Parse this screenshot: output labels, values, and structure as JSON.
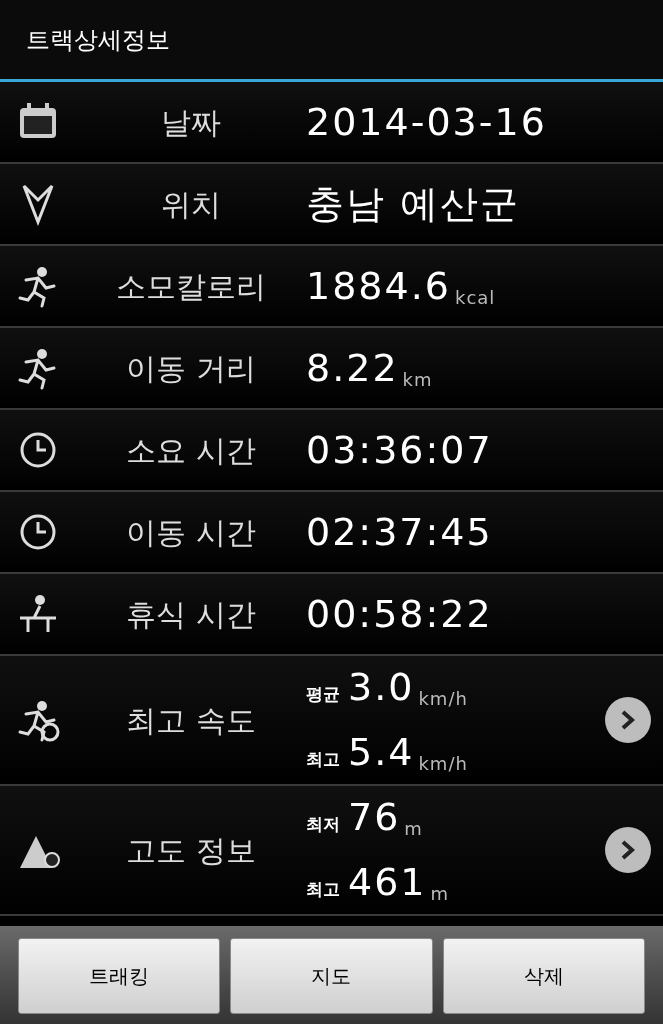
{
  "window": {
    "title": "트랙상세정보"
  },
  "rows": [
    {
      "kind": "single",
      "label": "날짜",
      "value": "2014-03-16"
    },
    {
      "kind": "single",
      "label": "위치",
      "value": "충남 예산군"
    },
    {
      "kind": "single",
      "label": "소모칼로리",
      "value": "1884.6",
      "unit": "kcal"
    },
    {
      "kind": "single",
      "label": "이동 거리",
      "value": "8.22",
      "unit": "km"
    },
    {
      "kind": "single",
      "label": "소요 시간",
      "value": "03:36:07"
    },
    {
      "kind": "single",
      "label": "이동 시간",
      "value": "02:37:45"
    },
    {
      "kind": "single",
      "label": "휴식 시간",
      "value": "00:58:22"
    },
    {
      "kind": "pair",
      "label": "최고 속도",
      "lines": [
        {
          "prefix": "평균",
          "value": "3.0",
          "unit": "km/h"
        },
        {
          "prefix": "최고",
          "value": "5.4",
          "unit": "km/h"
        }
      ]
    },
    {
      "kind": "pair",
      "label": "고도 정보",
      "lines": [
        {
          "prefix": "최저",
          "value": "76",
          "unit": "m"
        },
        {
          "prefix": "최고",
          "value": "461",
          "unit": "m"
        }
      ]
    }
  ],
  "buttons": [
    "트래킹",
    "지도",
    "삭제"
  ]
}
